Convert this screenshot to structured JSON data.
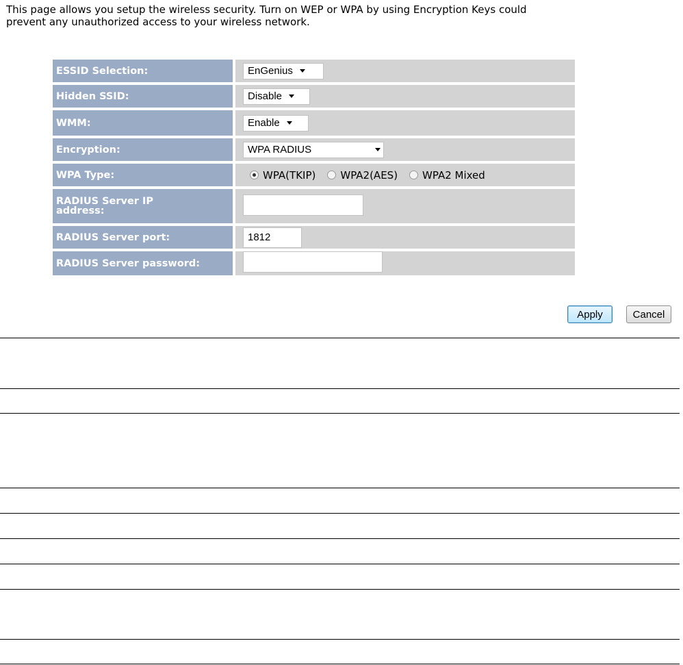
{
  "intro": {
    "line1": "This page allows you setup the wireless security. Turn on WEP or WPA by using Encryption Keys could",
    "line2": "prevent any unauthorized access to your wireless network."
  },
  "form": {
    "essid": {
      "label": "ESSID Selection:",
      "value": "EnGenius"
    },
    "hidden_ssid": {
      "label": "Hidden SSID:",
      "value": "Disable"
    },
    "wmm": {
      "label": "WMM:",
      "value": "Enable"
    },
    "encryption": {
      "label": "Encryption:",
      "value": "WPA RADIUS"
    },
    "wpa_type": {
      "label": "WPA Type:",
      "options": [
        {
          "label": "WPA(TKIP)",
          "selected": true
        },
        {
          "label": "WPA2(AES)",
          "selected": false
        },
        {
          "label": "WPA2 Mixed",
          "selected": false
        }
      ]
    },
    "radius_ip": {
      "label_line1": "RADIUS Server IP",
      "label_line2": "address:",
      "value": ""
    },
    "radius_port": {
      "label": "RADIUS Server port:",
      "value": "1812"
    },
    "radius_password": {
      "label": "RADIUS Server password:",
      "value": ""
    }
  },
  "buttons": {
    "apply": "Apply",
    "cancel": "Cancel"
  },
  "colors": {
    "label_bg": "#9aabc6",
    "value_bg": "#d3d3d3",
    "label_text": "#ffffff"
  }
}
